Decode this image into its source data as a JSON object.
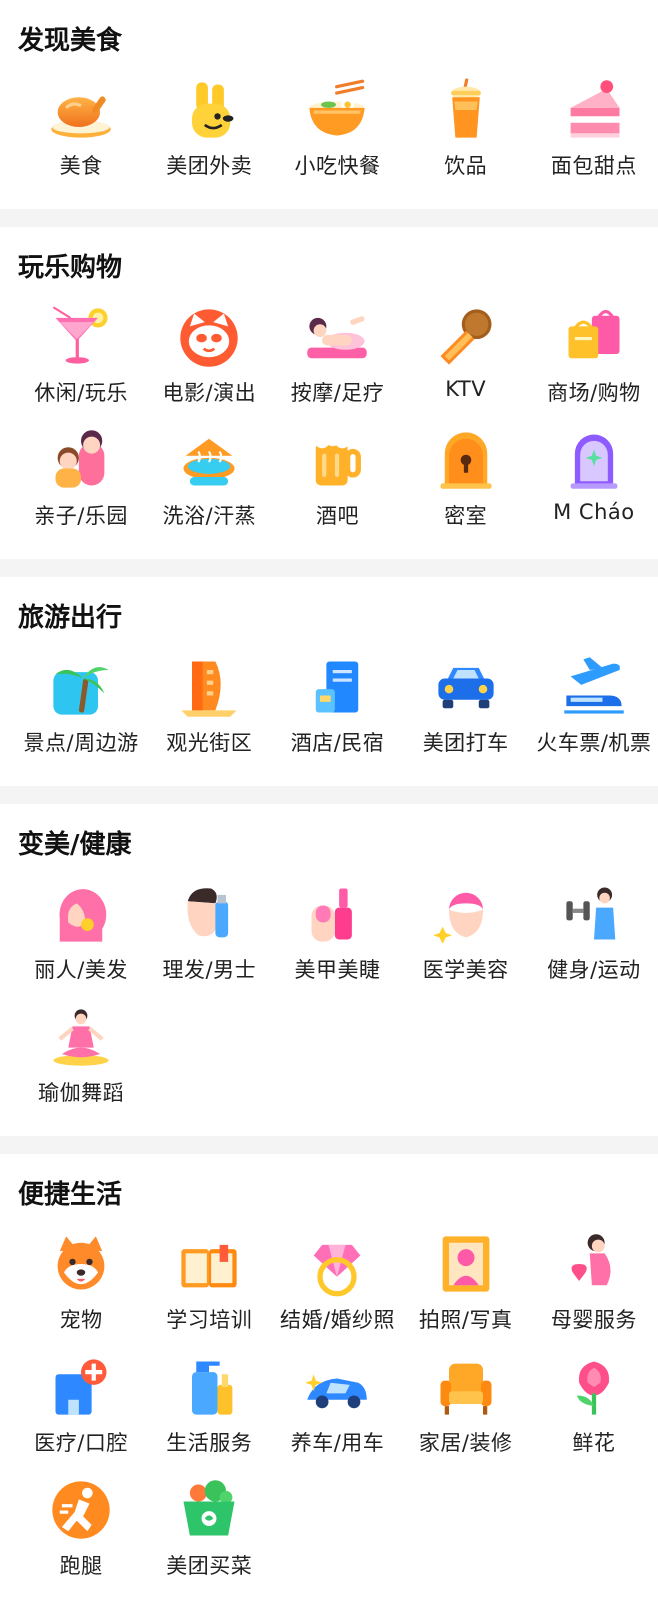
{
  "sections": [
    {
      "title": "发现美食",
      "items": [
        {
          "label": "美食",
          "icon": "roast-chicken-icon"
        },
        {
          "label": "美团外卖",
          "icon": "kangaroo-icon"
        },
        {
          "label": "小吃快餐",
          "icon": "noodle-bowl-icon"
        },
        {
          "label": "饮品",
          "icon": "drink-cup-icon"
        },
        {
          "label": "面包甜点",
          "icon": "cake-icon"
        }
      ]
    },
    {
      "title": "玩乐购物",
      "items": [
        {
          "label": "休闲/玩乐",
          "icon": "cocktail-icon"
        },
        {
          "label": "电影/演出",
          "icon": "cat-face-icon"
        },
        {
          "label": "按摩/足疗",
          "icon": "massage-icon"
        },
        {
          "label": "KTV",
          "icon": "microphone-icon"
        },
        {
          "label": "商场/购物",
          "icon": "shopping-bags-icon"
        },
        {
          "label": "亲子/乐园",
          "icon": "parent-child-icon"
        },
        {
          "label": "洗浴/汗蒸",
          "icon": "bath-icon"
        },
        {
          "label": "酒吧",
          "icon": "beer-mug-icon"
        },
        {
          "label": "密室",
          "icon": "locked-door-icon"
        },
        {
          "label": "M Cháo",
          "icon": "magic-mirror-icon"
        }
      ]
    },
    {
      "title": "旅游出行",
      "items": [
        {
          "label": "景点/周边游",
          "icon": "palm-tree-icon"
        },
        {
          "label": "观光街区",
          "icon": "building-icon"
        },
        {
          "label": "酒店/民宿",
          "icon": "hotel-icon"
        },
        {
          "label": "美团打车",
          "icon": "car-icon"
        },
        {
          "label": "火车票/机票",
          "icon": "plane-train-icon"
        }
      ]
    },
    {
      "title": "变美/健康",
      "items": [
        {
          "label": "丽人/美发",
          "icon": "woman-profile-icon"
        },
        {
          "label": "理发/男士",
          "icon": "barber-icon"
        },
        {
          "label": "美甲美睫",
          "icon": "nail-polish-icon"
        },
        {
          "label": "医学美容",
          "icon": "facial-care-icon"
        },
        {
          "label": "健身/运动",
          "icon": "dumbbell-icon"
        },
        {
          "label": "瑜伽舞蹈",
          "icon": "yoga-icon"
        }
      ]
    },
    {
      "title": "便捷生活",
      "items": [
        {
          "label": "宠物",
          "icon": "shiba-dog-icon"
        },
        {
          "label": "学习培训",
          "icon": "book-icon"
        },
        {
          "label": "结婚/婚纱照",
          "icon": "diamond-ring-icon"
        },
        {
          "label": "拍照/写真",
          "icon": "portrait-frame-icon"
        },
        {
          "label": "母婴服务",
          "icon": "pregnant-woman-icon"
        },
        {
          "label": "医疗/口腔",
          "icon": "hospital-icon"
        },
        {
          "label": "生活服务",
          "icon": "cleaning-icon"
        },
        {
          "label": "养车/用车",
          "icon": "sports-car-icon"
        },
        {
          "label": "家居/装修",
          "icon": "armchair-icon"
        },
        {
          "label": "鲜花",
          "icon": "flower-icon"
        },
        {
          "label": "跑腿",
          "icon": "running-man-icon"
        },
        {
          "label": "美团买菜",
          "icon": "vegetable-basket-icon"
        }
      ]
    }
  ]
}
